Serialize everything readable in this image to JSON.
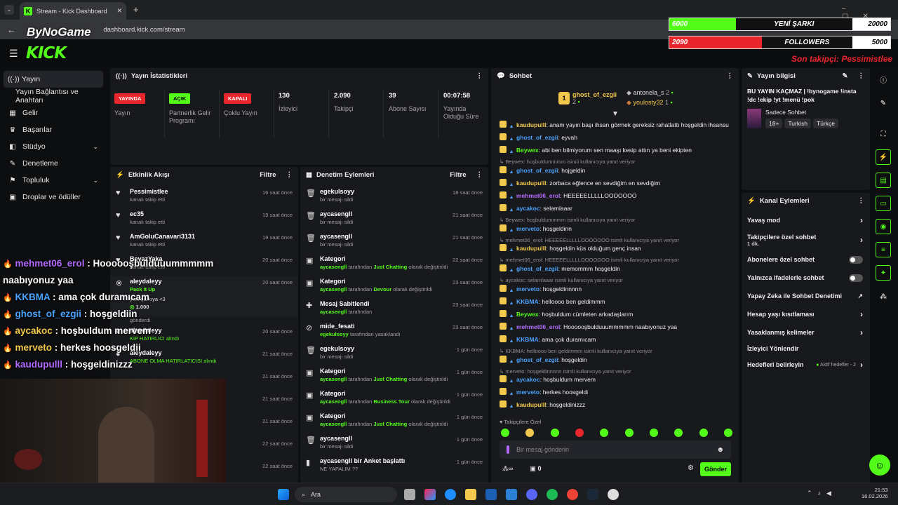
{
  "browser": {
    "tab_title": "Stream - Kick Dashboard",
    "url": "dashboard.kick.com/stream",
    "new_tab": "+",
    "close_tab": "✕"
  },
  "brand": {
    "kick": "KICK",
    "bynogame": "ByNoGame",
    "accent": "#53fc18"
  },
  "overlay_goals": {
    "song": {
      "current": "6000",
      "label": "YENİ ŞARKI",
      "target": "20000",
      "fraction": 0.3,
      "color": "#53fc18"
    },
    "followers": {
      "current": "2090",
      "label": "FOLLOWERS",
      "target": "5000",
      "fraction": 0.418,
      "color": "#e8262c"
    },
    "last_follower": "Son takipçi: Pessimistlee"
  },
  "left_nav": {
    "items": [
      {
        "label": "Yayın",
        "icon": "stream-icon"
      },
      {
        "label": "Yayın Bağlantısı ve Anahtarı",
        "icon": ""
      },
      {
        "label": "Gelir",
        "icon": "revenue-icon"
      },
      {
        "label": "Başarılar",
        "icon": "trophy-icon"
      },
      {
        "label": "Stüdyo",
        "icon": "studio-icon"
      },
      {
        "label": "Denetleme",
        "icon": "wrench-icon"
      },
      {
        "label": "Topluluk",
        "icon": "community-icon"
      },
      {
        "label": "Droplar ve ödüller",
        "icon": "drops-icon"
      }
    ]
  },
  "stats": {
    "title": "Yayın İstatistikleri",
    "items": [
      {
        "badge": "YAYINDA",
        "label": "Yayın"
      },
      {
        "badge": "AÇIK",
        "label": "Partnerlik Gelir Programı"
      },
      {
        "badge": "KAPALI",
        "label": "Çoklu Yayın"
      },
      {
        "value": "130",
        "label": "İzleyici"
      },
      {
        "value": "2.090",
        "label": "Takipçi"
      },
      {
        "value": "39",
        "label": "Abone Sayısı"
      },
      {
        "value": "00:07:58",
        "label": "Yayında Olduğu Süre"
      }
    ]
  },
  "activity": {
    "title": "Etkinlik Akışı",
    "filter": "Filtre",
    "rows": [
      {
        "name": "Pessimistlee",
        "sub": "kanalı takip etti",
        "time": "16 saat önce"
      },
      {
        "name": "ec35",
        "sub": "kanalı takip etti",
        "time": "19 saat önce"
      },
      {
        "name": "AmGoluCanavari3131",
        "sub": "kanalı takip etti",
        "time": "19 saat önce"
      },
      {
        "name": "BeyazYaka",
        "sub": "kanalı takip etti",
        "time": "20 saat önce"
      },
      {
        "name": "aleydaleyy",
        "sub": "Pack It Up",
        "time": "20 saat önce"
      },
      {
        "name": "yeni şarkıya <3",
        "sub": "1.000",
        "time": ""
      },
      {
        "name": "aleydaleyy",
        "sub": "KİP HATIRLICI alındı",
        "time": "20 saat önce"
      },
      {
        "name": "aleydaleyy",
        "sub": "ABONE OLMA HATIRLATICISI alındı",
        "time": "21 saat önce"
      }
    ],
    "gonderdi": "gönderdi",
    "extra_times": [
      "21 saat önce",
      "21 saat önce",
      "21 saat önce",
      "22 saat önce",
      "22 saat önce"
    ]
  },
  "moderation": {
    "title": "Denetim Eylemleri",
    "filter": "Filtre",
    "rows": [
      {
        "name": "egekulsoyy",
        "sub": "bir mesajı sildi",
        "time": "18 saat önce",
        "icon": "trash-icon"
      },
      {
        "name": "aycasengll",
        "sub": "bir mesajı sildi",
        "time": "21 saat önce",
        "icon": "trash-icon"
      },
      {
        "name": "aycasengll",
        "sub": "bir mesajı sildi",
        "time": "21 saat önce",
        "icon": "trash-icon"
      },
      {
        "name": "Kategori",
        "sub_user": "aycasengll",
        "sub_mid": "tarafından",
        "sub_cat": "Just Chatting",
        "sub_end": "olarak değiştirildi",
        "time": "22 saat önce",
        "icon": "category-icon"
      },
      {
        "name": "Kategori",
        "sub_user": "aycasengll",
        "sub_mid": "tarafından",
        "sub_cat": "Devour",
        "sub_end": "olarak değiştirildi",
        "time": "23 saat önce",
        "icon": "category-icon"
      },
      {
        "name": "Mesaj Sabitlendi",
        "sub_user": "aycasengll",
        "sub_mid": "tarafından",
        "sub_cat": "",
        "sub_end": "",
        "time": "23 saat önce",
        "icon": "pin-icon"
      },
      {
        "name": "mide_fesati",
        "sub_user": "egekulsoyy",
        "sub_mid": "tarafından yasaklandı",
        "sub_cat": "",
        "sub_end": "",
        "time": "23 saat önce",
        "icon": "ban-icon"
      },
      {
        "name": "egekulsoyy",
        "sub": "bir mesajı sildi",
        "time": "1 gün önce",
        "icon": "trash-icon"
      },
      {
        "name": "Kategori",
        "sub_user": "aycasengll",
        "sub_mid": "tarafından",
        "sub_cat": "Just Chatting",
        "sub_end": "olarak değiştirildi",
        "time": "1 gün önce",
        "icon": "category-icon"
      },
      {
        "name": "Kategori",
        "sub_user": "aycasengll",
        "sub_mid": "tarafından",
        "sub_cat": "Business Tour",
        "sub_end": "olarak değiştirildi",
        "time": "1 gün önce",
        "icon": "category-icon"
      },
      {
        "name": "Kategori",
        "sub_user": "aycasengll",
        "sub_mid": "tarafından",
        "sub_cat": "Just Chatting",
        "sub_end": "olarak değiştirildi",
        "time": "1 gün önce",
        "icon": "category-icon"
      },
      {
        "name": "aycasengll",
        "sub": "bir mesajı sildi",
        "time": "1 gün önce",
        "icon": "trash-icon"
      },
      {
        "name": "aycasengll bir Anket başlattı",
        "sub": "NE YAPALIM ??",
        "time": "1 gün önce",
        "icon": "poll-icon"
      }
    ]
  },
  "chat": {
    "title": "Sohbet",
    "top": [
      {
        "name": "ghost_of_ezgii",
        "count": "2"
      },
      {
        "name": "antonela_s",
        "count": "2"
      },
      {
        "name": "youlosty32",
        "count": "1"
      }
    ],
    "messages": [
      {
        "user": "kaudupulll",
        "color": "#f2c94c",
        "text": ": anam yayın başı ihsan görmek gereksiz rahatlattı hoşgeldin ihsansu"
      },
      {
        "user": "ghost_of_ezgii",
        "color": "#4aa3ff",
        "text": ": eyvah"
      },
      {
        "user": "Beywex",
        "color": "#53fc18",
        "text": ": abi ben bilmiyorum sen maaşı kesip attın ya beni ekipten"
      },
      {
        "reply": "Beywex: hoşbuldummmm isimli kullanıcıya yanıt veriyor"
      },
      {
        "user": "ghost_of_ezgii",
        "color": "#4aa3ff",
        "text": ": hojgeldin"
      },
      {
        "user": "kaudupulll",
        "color": "#f2c94c",
        "text": ": zorbaca eğlence en sevdiğim en sevdiğim"
      },
      {
        "user": "mehmet06_erol",
        "color": "#b36bff",
        "text": ": HEEEEELLLLLOOOOOOO"
      },
      {
        "user": "aycakoc",
        "color": "#4aa3ff",
        "text": ": selamlaaar"
      },
      {
        "reply": "Beywex: hoşbuldummmm isimli kullanıcıya yanıt veriyor"
      },
      {
        "user": "merveto",
        "color": "#4aa3ff",
        "text": ": hoşgeldinn"
      },
      {
        "reply": "mehmet06_erol: HEEEEELLLLLOOOOOOO isimli kullanıcıya yanıt veriyor"
      },
      {
        "user": "kaudupulll",
        "color": "#f2c94c",
        "text": ": hoşgeldin küs olduğum genç insan"
      },
      {
        "reply": "mehmet06_erol: HEEEEELLLLLOOOOOOO isimli kullanıcıya yanıt veriyor"
      },
      {
        "user": "ghost_of_ezgii",
        "color": "#4aa3ff",
        "text": ": memommm hoşgeldin"
      },
      {
        "reply": "aycakoc: selamlaaar isimli kullanıcıya yanıt veriyor"
      },
      {
        "user": "merveto",
        "color": "#4aa3ff",
        "text": ": hoşgeldinnnnn"
      },
      {
        "user": "KKBMA",
        "color": "#4aa3ff",
        "text": ": helloooo ben geldimmm"
      },
      {
        "user": "Beywex",
        "color": "#53fc18",
        "text": ": hoşbuldum cümleten arkadaşlarım"
      },
      {
        "user": "mehmet06_erol",
        "color": "#b36bff",
        "text": ": Hoooooşbulduuummmmm naabıyonuz yaa"
      },
      {
        "user": "KKBMA",
        "color": "#4aa3ff",
        "text": ": ama çok duramıcam"
      },
      {
        "reply": "KKBMA: helloooo ben geldimmm isimli kullanıcıya yanıt veriyor"
      },
      {
        "user": "ghost_of_ezgii",
        "color": "#4aa3ff",
        "text": ": hoşgeldin"
      },
      {
        "reply": "merveto: hoşgeldinnnnn isimli kullanıcıya yanıt veriyor"
      },
      {
        "user": "aycakoc",
        "color": "#4aa3ff",
        "text": ": hoşbuldum mervem"
      },
      {
        "user": "merveto",
        "color": "#4aa3ff",
        "text": ": herkes hoosgeldi"
      },
      {
        "user": "kaudupulll",
        "color": "#f2c94c",
        "text": ": hoşgeldinizzz"
      }
    ],
    "emote_label": "Takipçilere Özel",
    "input_placeholder": "Bir mesaj gönderin",
    "send": "Gönder",
    "points": "0"
  },
  "stream_info": {
    "title": "Yayın bilgisi",
    "stream_title": "BU YAYIN KAÇMAZ | !bynogame !insta !dc !ekip !yt !menü !pok",
    "category": "Sadece Sohbet",
    "tags": [
      "18+",
      "Turkish",
      "Türkçe"
    ]
  },
  "channel_actions": {
    "title": "Kanal Eylemleri",
    "items": [
      {
        "label": "Yavaş mod",
        "kind": "chevron"
      },
      {
        "label": "Takipçilere özel sohbet",
        "sub": "1 dk.",
        "kind": "chevron"
      },
      {
        "label": "Abonelere özel sohbet",
        "kind": "toggle"
      },
      {
        "label": "Yalnızca ifadelerle sohbet",
        "kind": "toggle"
      },
      {
        "label": "Yapay Zeka ile Sohbet Denetimi",
        "kind": "external"
      },
      {
        "label": "Hesap yaşı kısıtlaması",
        "kind": "chevron"
      },
      {
        "label": "Yasaklanmış kelimeler",
        "kind": "chevron"
      },
      {
        "label": "İzleyici Yönlendir",
        "kind": "none"
      },
      {
        "label": "Hedefleri belirleyin",
        "extra": "Aktif hedefler - 2",
        "kind": "chevron"
      }
    ]
  },
  "overlay_chat": [
    {
      "user": "mehmet06_erol",
      "color": "#b36bff",
      "text": " : Hoooooşbulduuummmmm"
    },
    {
      "user": "",
      "color": "#fff",
      "text": "naabıyonuz yaa"
    },
    {
      "user": "KKBMA",
      "color": "#4aa3ff",
      "text": " : ama çok duramıcam"
    },
    {
      "user": "ghost_of_ezgii",
      "color": "#4aa3ff",
      "text": " : hoşgeldiin"
    },
    {
      "user": "aycakoc",
      "color": "#f2c94c",
      "text": " : hoşbuldum mervem"
    },
    {
      "user": "merveto",
      "color": "#f2c94c",
      "text": " : herkes hoosgeldii"
    },
    {
      "user": "kaudupulll",
      "color": "#b36bff",
      "text": " : hoşgeldinizzz"
    }
  ],
  "taskbar": {
    "search": "Ara",
    "time": "21:53",
    "date": "16.02.2026"
  }
}
